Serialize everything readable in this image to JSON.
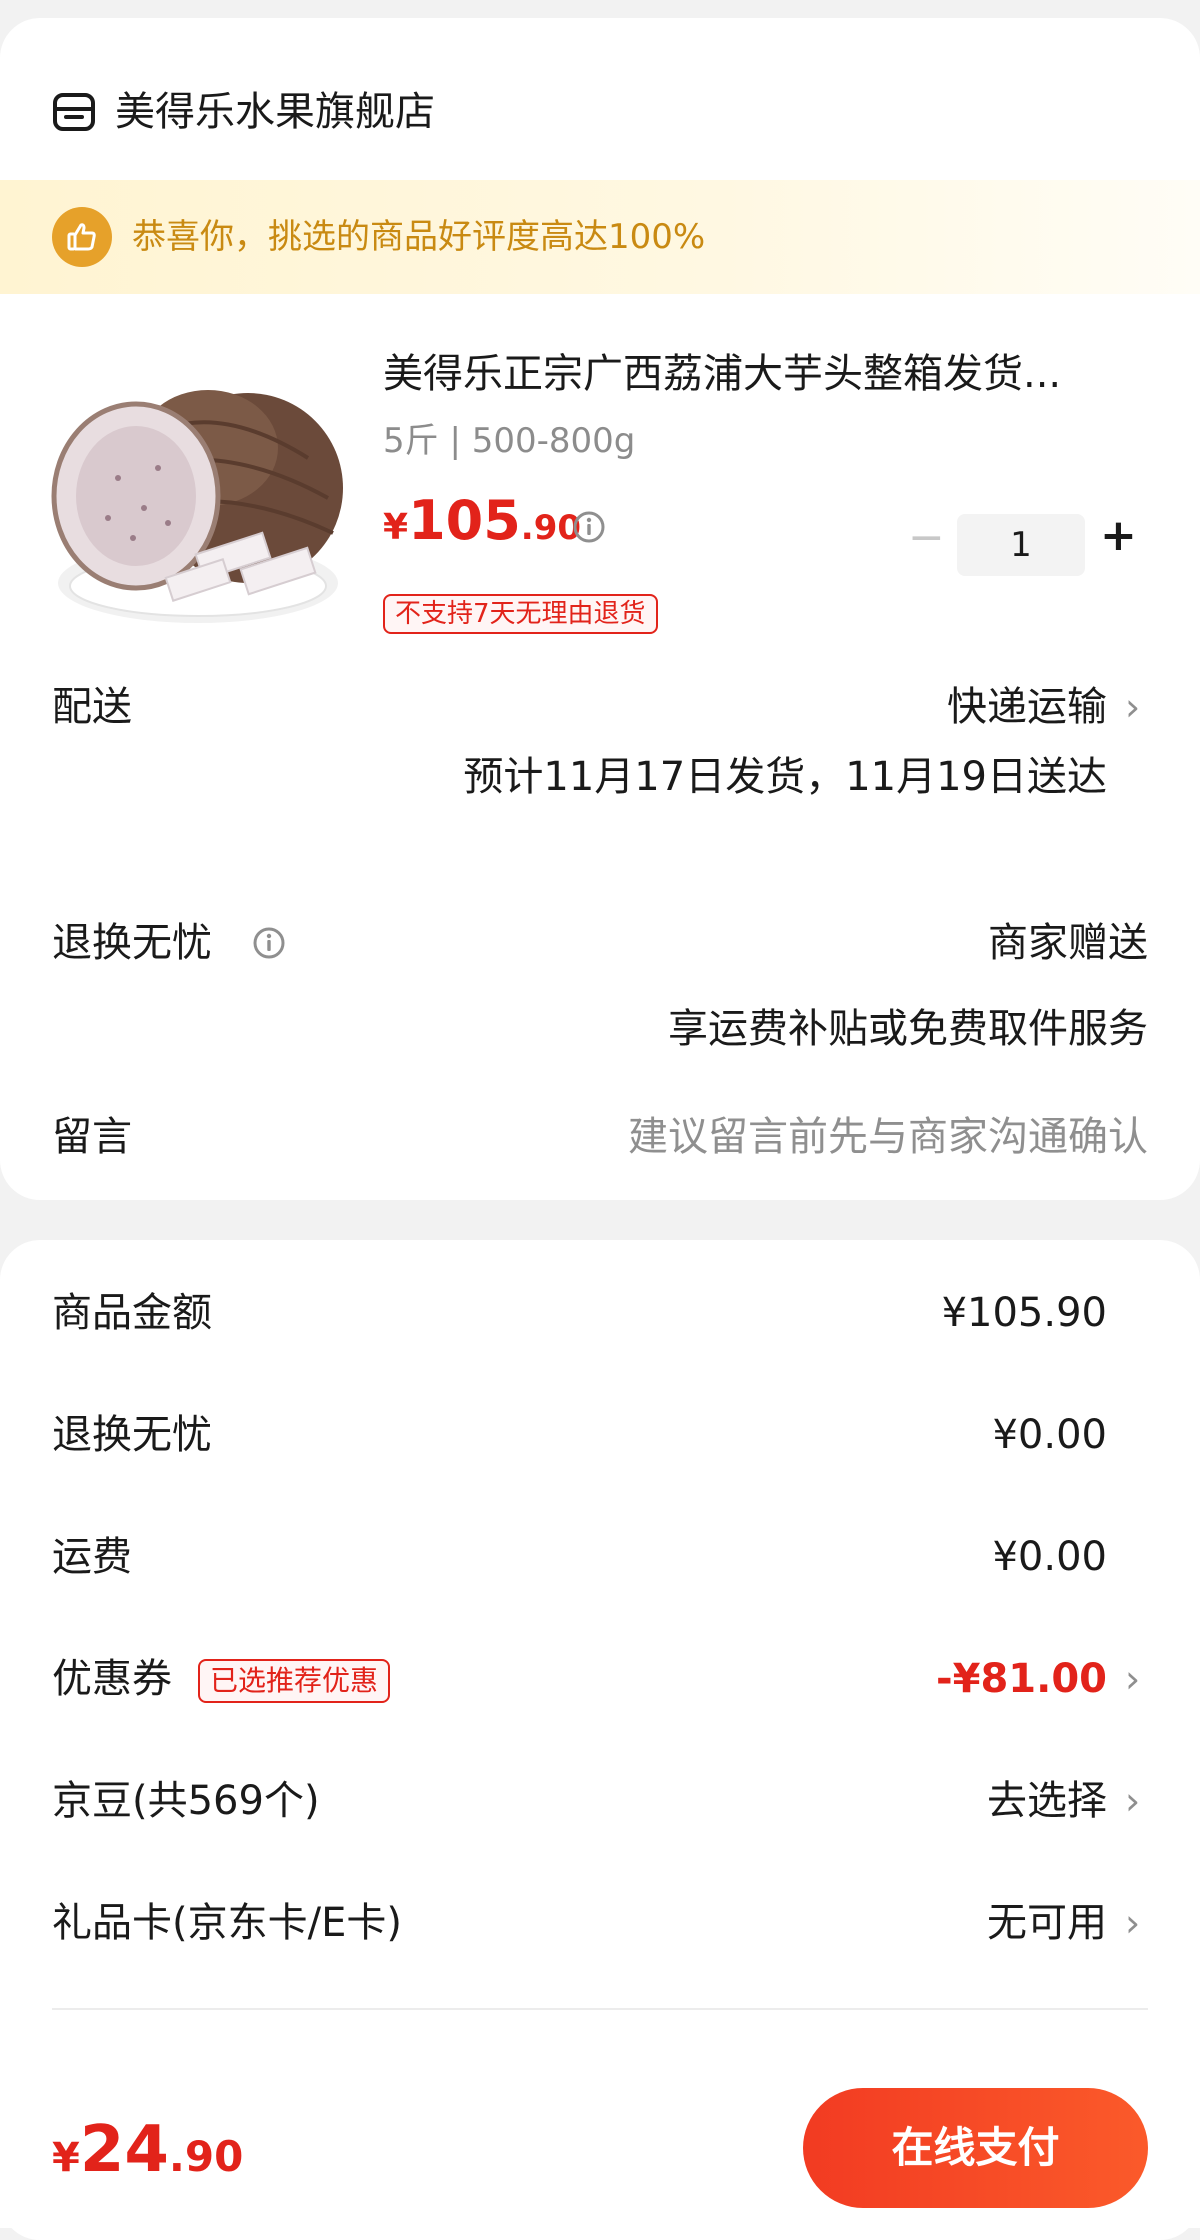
{
  "store": {
    "name": "美得乐水果旗舰店",
    "icon": "store-icon"
  },
  "banner": {
    "text": "恭喜你，挑选的商品好评度高达100%",
    "icon": "thumbs-up-icon",
    "color": "#c98a12"
  },
  "product": {
    "title": "美得乐正宗广西荔浦大芋头整箱发货...",
    "spec": "5斤 | 500-800g",
    "price": {
      "currency": "¥",
      "integer": "105",
      "decimal": ".90"
    },
    "quantity": "1",
    "minus": "−",
    "plus": "+",
    "return_tag": "不支持7天无理由退货"
  },
  "delivery": {
    "label": "配送",
    "method": "快递运输",
    "estimate": "预计11月17日发货，11月19日送达"
  },
  "worry_free": {
    "label": "退换无忧",
    "value": "商家赠送",
    "detail": "享运费补贴或免费取件服务"
  },
  "message": {
    "label": "留言",
    "placeholder": "建议留言前先与商家沟通确认"
  },
  "summary": [
    {
      "label": "商品金额",
      "value": "¥105.90"
    },
    {
      "label": "退换无忧",
      "value": "¥0.00"
    },
    {
      "label": "运费",
      "value": "¥0.00"
    },
    {
      "label": "优惠券",
      "tag": "已选推荐优惠",
      "value": "-¥81.00"
    },
    {
      "label": "京豆(共569个)",
      "value": "去选择"
    },
    {
      "label": "礼品卡(京东卡/E卡)",
      "value": "无可用"
    }
  ],
  "chevron": "›",
  "footer": {
    "total": {
      "currency": "¥",
      "integer": "24",
      "decimal": ".90"
    },
    "pay_button": "在线支付"
  },
  "colors": {
    "accent_red": "#e2231a",
    "banner_gold": "#e6a12a"
  }
}
